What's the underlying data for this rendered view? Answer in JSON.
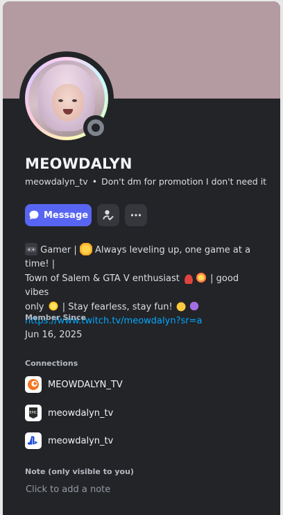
{
  "colors": {
    "banner": "#b49ba1",
    "card_bg": "#232428",
    "accent": "#5865f2",
    "link": "#00a8fc",
    "status_offline": "#80848e"
  },
  "profile": {
    "display_name": "MEOWDALYN",
    "username": "meowdalyn_tv",
    "separator": "•",
    "custom_status": "Don't dm for promotion I don't need it",
    "status": "offline"
  },
  "actions": {
    "message_label": "Message",
    "message_icon": "chat-bubble-icon",
    "friend_icon": "add-friend-icon",
    "more_icon": "more-icon"
  },
  "bio": {
    "line1_a": "Gamer |",
    "line1_b": "Always leveling up, one game at a time! |",
    "line2_a": "Town of Salem & GTA V enthusiast",
    "line2_b": "|  good vibes",
    "line3_a": "only",
    "line3_b": "| Stay fearless, stay fun!",
    "link": "https://www.twitch.tv/meowdalyn?sr=a"
  },
  "member_since": {
    "label": "Member Since",
    "date": "Jun 16, 2025"
  },
  "connections": {
    "label": "Connections",
    "items": [
      {
        "name": "MEOWDALYN_TV",
        "icon": "crunchyroll-icon"
      },
      {
        "name": "meowdalyn_tv",
        "icon": "epic-games-icon"
      },
      {
        "name": "meowdalyn_tv",
        "icon": "playstation-icon"
      }
    ]
  },
  "note": {
    "label": "Note (only visible to you)",
    "placeholder": "Click to add a note"
  }
}
